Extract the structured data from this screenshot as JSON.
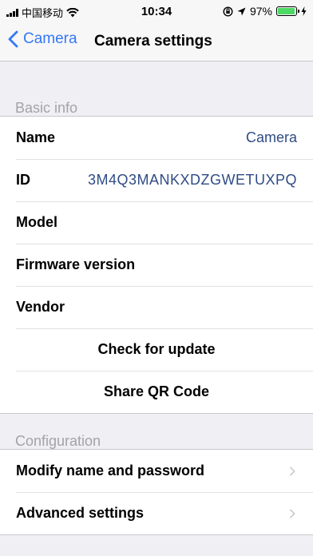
{
  "status": {
    "carrier": "中国移动",
    "time": "10:34",
    "battery": "97%",
    "battery_level": 0.97
  },
  "nav": {
    "back_label": "Camera",
    "title": "Camera settings"
  },
  "basic": {
    "header": "Basic info",
    "name_label": "Name",
    "name_value": "Camera",
    "id_label": "ID",
    "id_value": "3M4Q3MANKXDZGWETUXPQ",
    "model_label": "Model",
    "firmware_label": "Firmware version",
    "vendor_label": "Vendor",
    "check_update": "Check for update",
    "share_qr": "Share QR Code"
  },
  "config": {
    "header": "Configuration",
    "modify": "Modify name and password",
    "advanced": "Advanced settings"
  },
  "colors": {
    "accent": "#3478f6",
    "value_text": "#2f4c85",
    "battery": "#4cd964"
  }
}
